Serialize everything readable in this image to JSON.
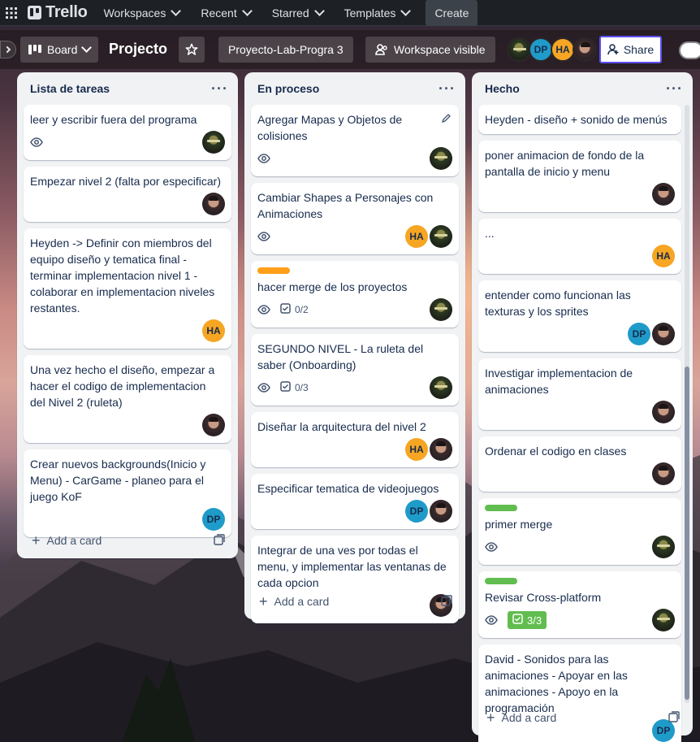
{
  "topnav": {
    "logo": "Trello",
    "items": [
      {
        "label": "Workspaces"
      },
      {
        "label": "Recent"
      },
      {
        "label": "Starred"
      },
      {
        "label": "Templates"
      }
    ],
    "create_label": "Create"
  },
  "board": {
    "view_label": "Board",
    "title": "Projecto",
    "workspace_name": "Proyecto-Lab-Progra 3",
    "visibility_label": "Workspace visible",
    "share_label": "Share",
    "members": [
      "photo1",
      "DP",
      "HA",
      "photo2"
    ]
  },
  "lists": [
    {
      "title": "Lista de tareas",
      "add_card": "Add a card",
      "cards": [
        {
          "text": "leer y escribir fuera del programa",
          "watch": true,
          "members": [
            "photo1"
          ]
        },
        {
          "text": "Empezar nivel 2 (falta por especificar)",
          "members": [
            "photo2"
          ]
        },
        {
          "text": "Heyden -> Definir con miembros del equipo diseño y tematica final - terminar implementacion nivel 1 - colaborar en implementacion niveles restantes.",
          "members": [
            "HA"
          ]
        },
        {
          "text": "Una vez hecho el diseño, empezar a hacer el codigo de implementacion del Nivel 2 (ruleta)",
          "members": [
            "photo2"
          ]
        },
        {
          "text": "Crear nuevos backgrounds(Inicio y Menu) - CarGame - planeo para el juego KoF",
          "members": [
            "DP"
          ]
        }
      ]
    },
    {
      "title": "En proceso",
      "add_card": "Add a card",
      "cards": [
        {
          "text": "Agregar Mapas y Objetos de colisiones",
          "watch": true,
          "edit": true,
          "members": [
            "photo1"
          ]
        },
        {
          "text": "Cambiar Shapes a Personajes con Animaciones",
          "watch": true,
          "members": [
            "HA",
            "photo1"
          ]
        },
        {
          "text": "hacer merge de los proyectos",
          "label": "#ff9f1a",
          "watch": true,
          "checklist": "0/2",
          "members": [
            "photo1"
          ]
        },
        {
          "text": "SEGUNDO NIVEL - La ruleta del saber (Onboarding)",
          "watch": true,
          "checklist": "0/3",
          "members": [
            "photo1"
          ]
        },
        {
          "text": "Diseñar la arquitectura del nivel 2",
          "members": [
            "HA",
            "photo2"
          ]
        },
        {
          "text": "Especificar tematica de videojuegos",
          "members": [
            "DP",
            "photo2"
          ]
        },
        {
          "text": "Integrar de una ves por todas el menu, y implementar las ventanas de cada opcion",
          "members": [
            "photo2"
          ]
        }
      ]
    },
    {
      "title": "Hecho",
      "add_card": "Add a card",
      "cards": [
        {
          "text": "Heyden - diseño + sonido de menús",
          "members": []
        },
        {
          "text": "poner animacion de fondo de la pantalla de inicio y menu",
          "members": [
            "photo2"
          ]
        },
        {
          "text": "...",
          "members": [
            "HA"
          ]
        },
        {
          "text": "entender como funcionan las texturas y los sprites",
          "members": [
            "DP",
            "photo2"
          ]
        },
        {
          "text": "Investigar implementacion de animaciones",
          "members": [
            "photo2"
          ]
        },
        {
          "text": "Ordenar el codigo en clases",
          "members": [
            "photo2"
          ]
        },
        {
          "text": "primer merge",
          "label": "#61bd4f",
          "watch": true,
          "members": [
            "photo1"
          ]
        },
        {
          "text": "Revisar Cross-platform",
          "label": "#61bd4f",
          "watch": true,
          "checklist_done": "3/3",
          "members": [
            "photo1"
          ]
        },
        {
          "text": "David - Sonidos para las animaciones - Apoyar en las animaciones - Apoyo en la programación",
          "members": [
            "DP"
          ]
        }
      ]
    }
  ],
  "colors": {
    "topnav_bg": "#1d2125",
    "list_bg": "#f1f2f4",
    "ha_avatar": "#f6a623",
    "dp_avatar": "#1f9bc9",
    "share_border": "#5b4ff0"
  }
}
